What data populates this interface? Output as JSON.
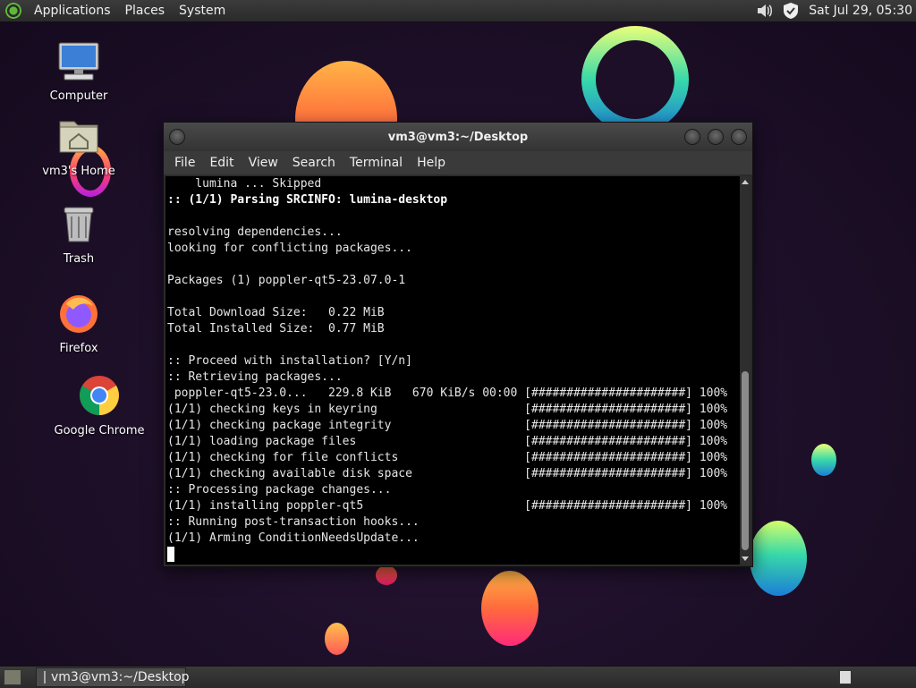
{
  "top_panel": {
    "menus": [
      "Applications",
      "Places",
      "System"
    ],
    "clock": "Sat Jul 29, 05:30"
  },
  "desktop_icons": [
    {
      "label": "Computer"
    },
    {
      "label": "vm3's Home"
    },
    {
      "label": "Trash"
    },
    {
      "label": "Firefox"
    },
    {
      "label": "Google Chrome"
    }
  ],
  "terminal": {
    "title": "vm3@vm3:~/Desktop",
    "menu": [
      "File",
      "Edit",
      "View",
      "Search",
      "Terminal",
      "Help"
    ],
    "lines": [
      "    lumina ... Skipped",
      ":: (1/1) Parsing SRCINFO: lumina-desktop",
      "",
      "resolving dependencies...",
      "looking for conflicting packages...",
      "",
      "Packages (1) poppler-qt5-23.07.0-1",
      "",
      "Total Download Size:   0.22 MiB",
      "Total Installed Size:  0.77 MiB",
      "",
      ":: Proceed with installation? [Y/n]",
      ":: Retrieving packages...",
      " poppler-qt5-23.0...   229.8 KiB   670 KiB/s 00:00 [######################] 100%",
      "(1/1) checking keys in keyring                     [######################] 100%",
      "(1/1) checking package integrity                   [######################] 100%",
      "(1/1) loading package files                        [######################] 100%",
      "(1/1) checking for file conflicts                  [######################] 100%",
      "(1/1) checking available disk space                [######################] 100%",
      ":: Processing package changes...",
      "(1/1) installing poppler-qt5                       [######################] 100%",
      ":: Running post-transaction hooks...",
      "(1/1) Arming ConditionNeedsUpdate..."
    ]
  },
  "taskbar": {
    "task_label": "vm3@vm3:~/Desktop"
  },
  "icons": {
    "distro_menu": "mint-logo-icon",
    "volume": "volume-icon",
    "security": "shield-icon"
  }
}
